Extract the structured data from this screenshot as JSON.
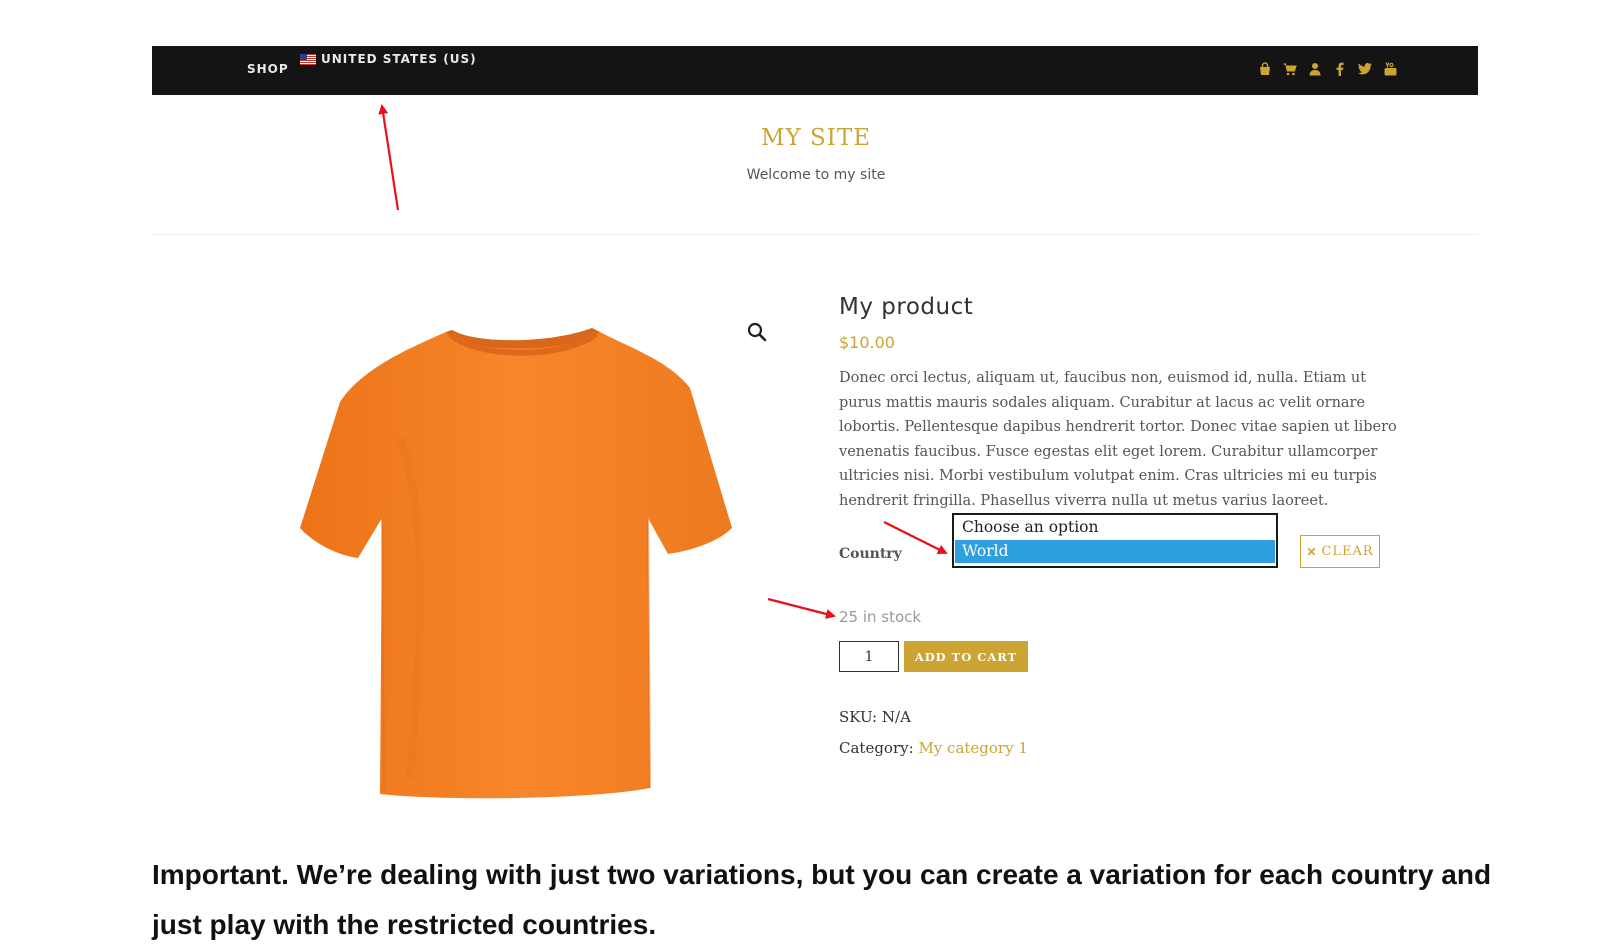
{
  "nav": {
    "shop_label": "SHOP",
    "country_label": "UNITED STATES (US)",
    "icons": [
      "shopping-bag-icon",
      "cart-icon",
      "user-icon",
      "facebook-icon",
      "twitter-icon",
      "youtube-icon"
    ],
    "icon_color": "#cca434",
    "background": "#141414"
  },
  "site": {
    "title": "MY SITE",
    "tagline": "Welcome to my site"
  },
  "product": {
    "title": "My product",
    "price": "$10.00",
    "description": "Donec orci lectus, aliquam ut, faucibus non, euismod id, nulla. Etiam ut purus mattis mauris sodales aliquam. Curabitur at lacus ac velit ornare lobortis. Pellentesque dapibus hendrerit tortor. Donec vitae sapien ut libero venenatis faucibus. Fusce egestas elit eget lorem. Curabitur ullamcorper ultricies nisi. Morbi vestibulum volutpat enim. Cras ultricies mi eu turpis hendrerit fringilla. Phasellus viverra nulla ut metus varius laoreet.",
    "variation_label": "Country",
    "variation_options": [
      "Choose an option",
      "World"
    ],
    "variation_selected": "World",
    "clear_label": "CLEAR",
    "stock": "25 in stock",
    "quantity": "1",
    "add_to_cart_label": "ADD TO CART",
    "sku_label": "SKU:",
    "sku_value": "N/A",
    "category_label": "Category:",
    "category_value": "My category 1",
    "accent_color": "#cca434",
    "image_color": "#f57f20"
  },
  "caption": "Important. We’re dealing with just two variations, but you can create a variation for each country and just play with the restricted countries."
}
